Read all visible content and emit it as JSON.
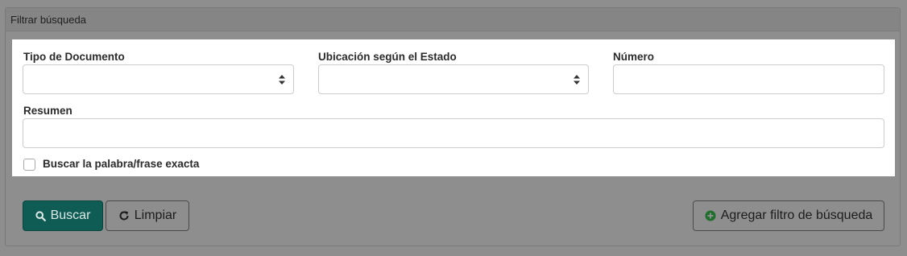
{
  "panel": {
    "title": "Filtrar búsqueda"
  },
  "form": {
    "tipo_documento": {
      "label": "Tipo de Documento",
      "value": ""
    },
    "ubicacion": {
      "label": "Ubicación según el Estado",
      "value": ""
    },
    "numero": {
      "label": "Número",
      "value": ""
    },
    "resumen": {
      "label": "Resumen",
      "value": ""
    },
    "exact_match": {
      "label": "Buscar la palabra/frase exacta",
      "checked": false
    }
  },
  "actions": {
    "search_label": "Buscar",
    "clear_label": "Limpiar",
    "add_filter_label": "Agregar filtro de búsqueda"
  },
  "icons": {
    "search": "search-icon",
    "clear": "refresh-icon",
    "add": "plus-circle-icon"
  },
  "colors": {
    "primary": "#0f5c55",
    "add_icon": "#1f6e2b"
  }
}
